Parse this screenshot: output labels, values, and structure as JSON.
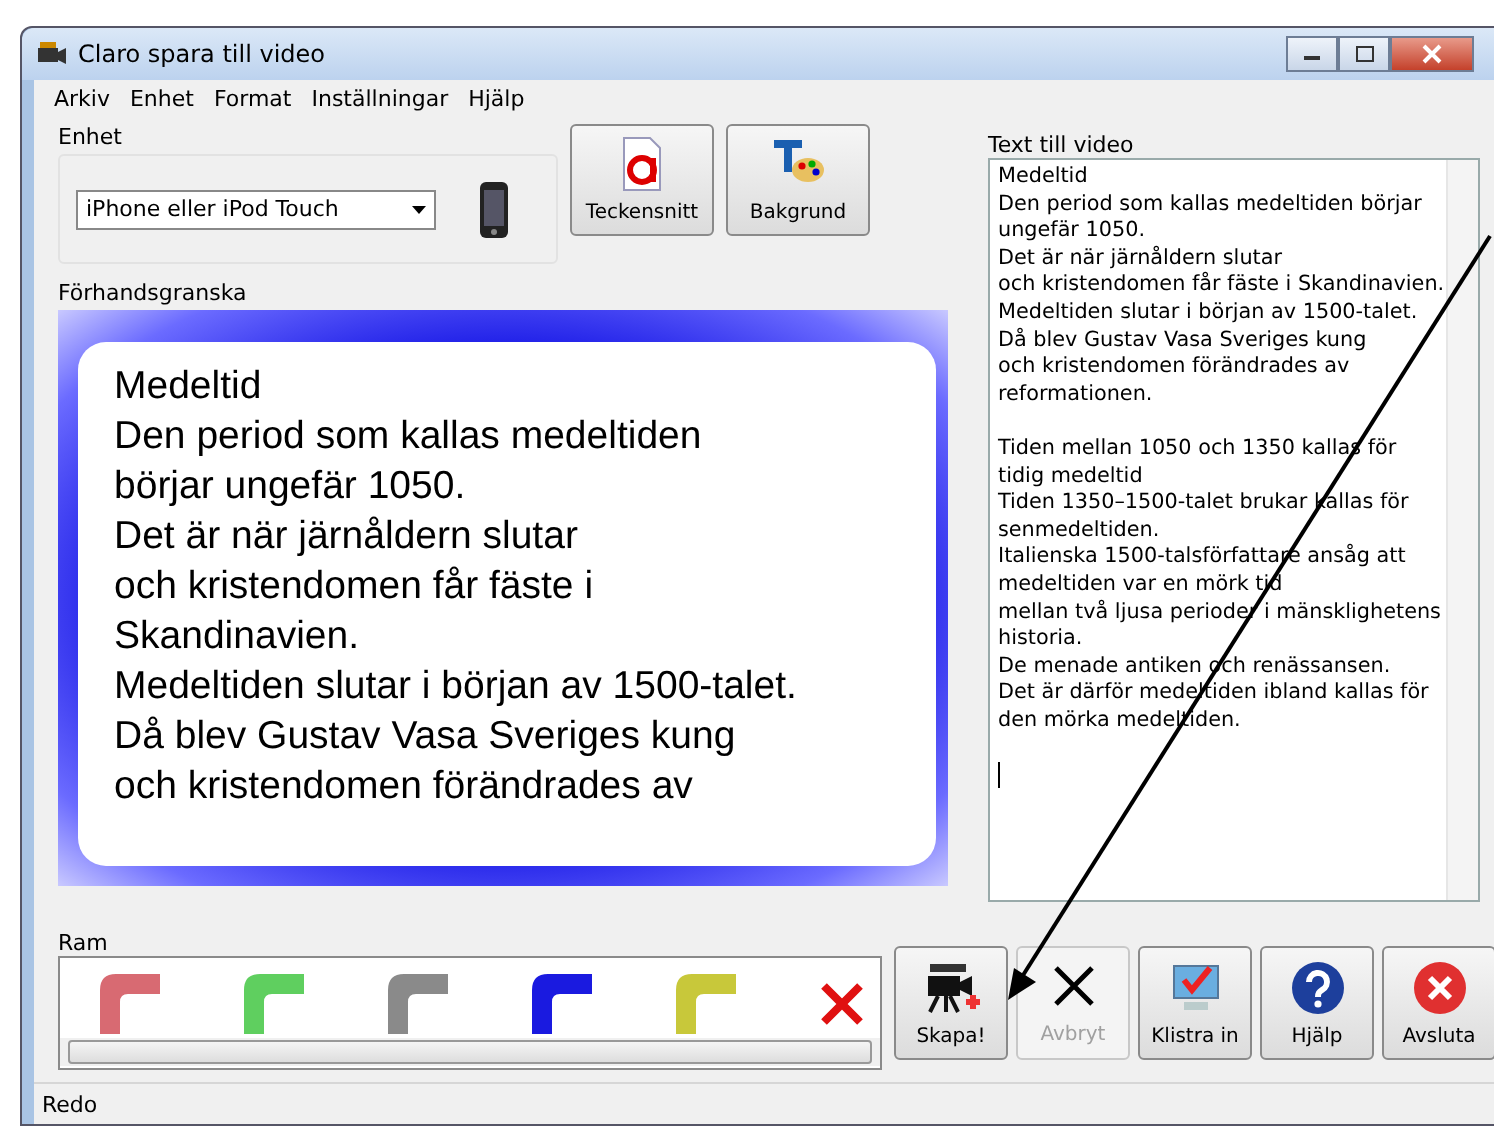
{
  "window": {
    "title": "Claro spara till video"
  },
  "menu": [
    "Arkiv",
    "Enhet",
    "Format",
    "Inställningar",
    "Hjälp"
  ],
  "device": {
    "label": "Enhet",
    "value": "iPhone eller iPod Touch"
  },
  "style_buttons": [
    {
      "kind": "font",
      "label": "Teckensnitt"
    },
    {
      "kind": "background",
      "label": "Bakgrund"
    }
  ],
  "preview": {
    "label": "Förhandsgranska",
    "lines": [
      "Medeltid",
      "Den period som kallas medeltiden",
      "börjar ungefär 1050.",
      "Det är när järnåldern slutar",
      "och kristendomen får fäste i",
      "Skandinavien.",
      "Medeltiden slutar i början av 1500-talet.",
      "Då blev Gustav Vasa Sveriges kung",
      "och kristendomen förändrades av"
    ]
  },
  "text_panel": {
    "label": "Text till video",
    "paragraphs": [
      [
        "Medeltid",
        "Den period som kallas medeltiden börjar",
        "ungefär 1050.",
        "Det är när järnåldern slutar",
        "och kristendomen får fäste i Skandinavien.",
        "Medeltiden slutar i början av 1500-talet.",
        "Då blev Gustav Vasa Sveriges kung",
        "och kristendomen förändrades av",
        "reformationen."
      ],
      [
        "Tiden mellan 1050 och 1350 kallas för",
        "tidig medeltid",
        "Tiden 1350–1500-talet brukar kallas för",
        "senmedeltiden.",
        "Italienska 1500-talsförfattare ansåg att",
        "medeltiden var en mörk tid",
        "mellan två ljusa perioder i mänsklighetens",
        "historia.",
        "De menade antiken och renässansen.",
        "Det är därför medeltiden ibland kallas för",
        "den mörka medeltiden."
      ]
    ]
  },
  "frames": {
    "label": "Ram",
    "items": [
      {
        "kind": "frame",
        "color": "#d86a72"
      },
      {
        "kind": "frame",
        "color": "#5fcf5f"
      },
      {
        "kind": "frame",
        "color": "#8a8a8a"
      },
      {
        "kind": "frame",
        "color": "#1a1ae0"
      },
      {
        "kind": "frame",
        "color": "#c8c83a"
      },
      {
        "kind": "none",
        "color": "#e01010"
      }
    ]
  },
  "actions": [
    {
      "kind": "create",
      "label": "Skapa!",
      "disabled": false
    },
    {
      "kind": "cancel",
      "label": "Avbryt",
      "disabled": true
    },
    {
      "kind": "paste",
      "label": "Klistra in",
      "disabled": false
    },
    {
      "kind": "help",
      "label": "Hjälp",
      "disabled": false
    },
    {
      "kind": "quit",
      "label": "Avsluta",
      "disabled": false
    }
  ],
  "status_bar": "Redo"
}
